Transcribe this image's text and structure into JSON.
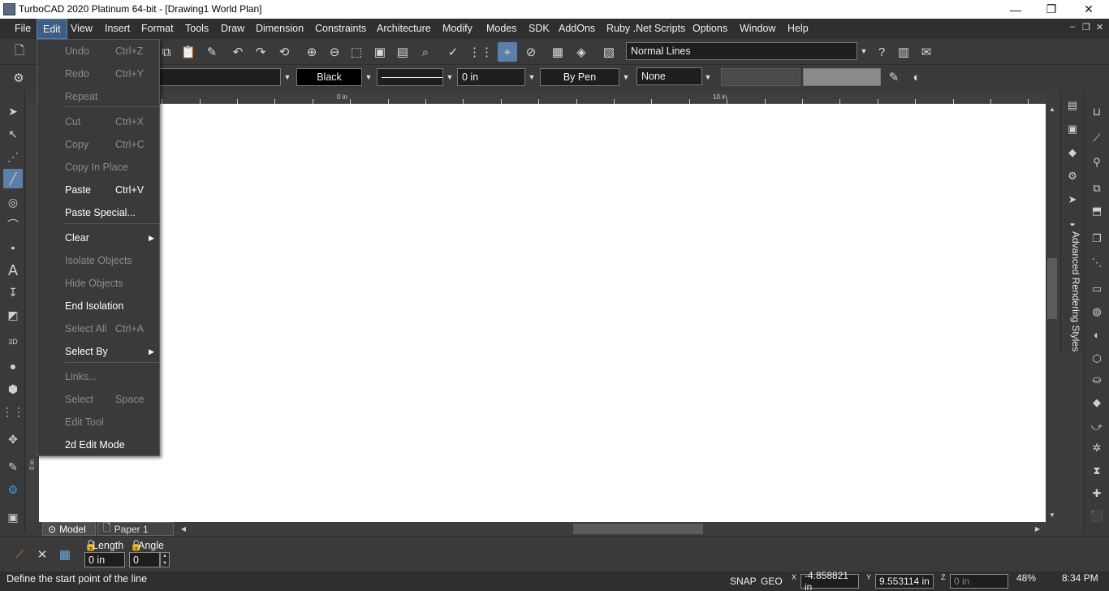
{
  "window": {
    "title": "TurboCAD 2020 Platinum 64-bit - [Drawing1 World Plan]",
    "controls": {
      "minimize": "—",
      "restore": "❐",
      "close": "✕"
    }
  },
  "menubar": {
    "items": [
      "File",
      "Edit",
      "View",
      "Insert",
      "Format",
      "Tools",
      "Draw",
      "Dimension",
      "Constraints",
      "Architecture",
      "Modify",
      "Modes",
      "SDK",
      "AddOns",
      "Ruby .Net Scripts",
      "Options",
      "Window",
      "Help"
    ],
    "active": "Edit",
    "mdi": {
      "minimize": "–",
      "restore": "❐",
      "close": "✕"
    }
  },
  "toolbar1": {
    "line_style": "Normal Lines"
  },
  "toolbar2": {
    "layer_value": "0",
    "color": "Black",
    "line_width": "0 in",
    "pen": "By Pen",
    "fill": "None"
  },
  "edit_menu": {
    "items": [
      {
        "label": "Undo",
        "shortcut": "Ctrl+Z",
        "enabled": false
      },
      {
        "label": "Redo",
        "shortcut": "Ctrl+Y",
        "enabled": false
      },
      {
        "label": "Repeat",
        "shortcut": "",
        "enabled": false
      },
      {
        "label": "Cut",
        "shortcut": "Ctrl+X",
        "enabled": false
      },
      {
        "label": "Copy",
        "shortcut": "Ctrl+C",
        "enabled": false
      },
      {
        "label": "Copy In Place",
        "shortcut": "",
        "enabled": false
      },
      {
        "label": "Paste",
        "shortcut": "Ctrl+V",
        "enabled": true
      },
      {
        "label": "Paste Special...",
        "shortcut": "",
        "enabled": true
      },
      {
        "label": "Clear",
        "shortcut": "",
        "enabled": true,
        "submenu": true
      },
      {
        "label": "Isolate Objects",
        "shortcut": "",
        "enabled": false
      },
      {
        "label": "Hide Objects",
        "shortcut": "",
        "enabled": false
      },
      {
        "label": "End Isolation",
        "shortcut": "",
        "enabled": true
      },
      {
        "label": "Select All",
        "shortcut": "Ctrl+A",
        "enabled": false
      },
      {
        "label": "Select By",
        "shortcut": "",
        "enabled": true,
        "submenu": true
      },
      {
        "label": "Links...",
        "shortcut": "",
        "enabled": false
      },
      {
        "label": "Select",
        "shortcut": "Space",
        "enabled": false
      },
      {
        "label": "Edit Tool",
        "shortcut": "",
        "enabled": false
      },
      {
        "label": "2d Edit Mode",
        "shortcut": "",
        "enabled": true
      }
    ]
  },
  "rulers": {
    "top_labels": [
      "0 in",
      "10 in"
    ],
    "left_label": "0 in"
  },
  "tabs": {
    "model": "Model",
    "paper": "Paper 1"
  },
  "right_panel": {
    "vertical_label": "Advanced Rendering Styles"
  },
  "inspector": {
    "length_label": "Length",
    "angle_label": "Angle",
    "length_value": "0 in",
    "angle_value": "0"
  },
  "statusbar": {
    "prompt": "Define the start point of the line",
    "snap": "SNAP",
    "geo": "GEO",
    "x_label": "X",
    "y_label": "Y",
    "z_label": "Z",
    "x_value": "-4.858821 in",
    "y_value": "9.553114 in",
    "z_value": "0 in",
    "zoom": "48%",
    "time": "8:34 PM"
  },
  "colors": {
    "accent": "#5a7fa8",
    "menu_bg": "#2f2f2f",
    "panel_bg": "#3a3a3a",
    "canvas_bg": "#ffffff"
  }
}
